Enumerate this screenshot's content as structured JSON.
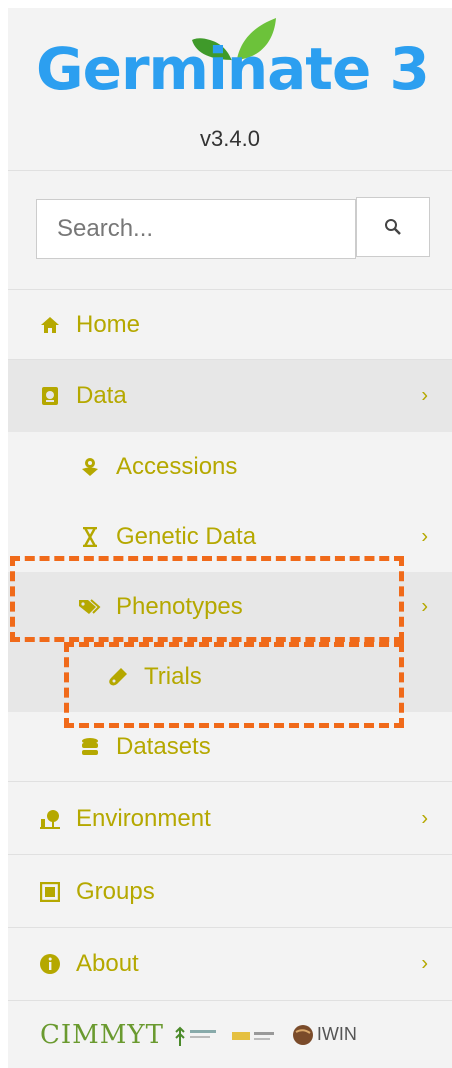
{
  "app": {
    "logo_text": "Germinate 3",
    "version": "v3.4.0"
  },
  "search": {
    "placeholder": "Search..."
  },
  "nav": {
    "home": "Home",
    "data": "Data",
    "accessions": "Accessions",
    "genetic_data": "Genetic Data",
    "phenotypes": "Phenotypes",
    "trials": "Trials",
    "datasets": "Datasets",
    "environment": "Environment",
    "groups": "Groups",
    "about": "About"
  },
  "footer": {
    "cimmyt": "CIMMYT",
    "iwin": "IWIN"
  },
  "colors": {
    "accent": "#b5a800",
    "brand_blue": "#2c9ff0",
    "leaf_green": "#5ab43c",
    "highlight": "#f06a1a"
  }
}
